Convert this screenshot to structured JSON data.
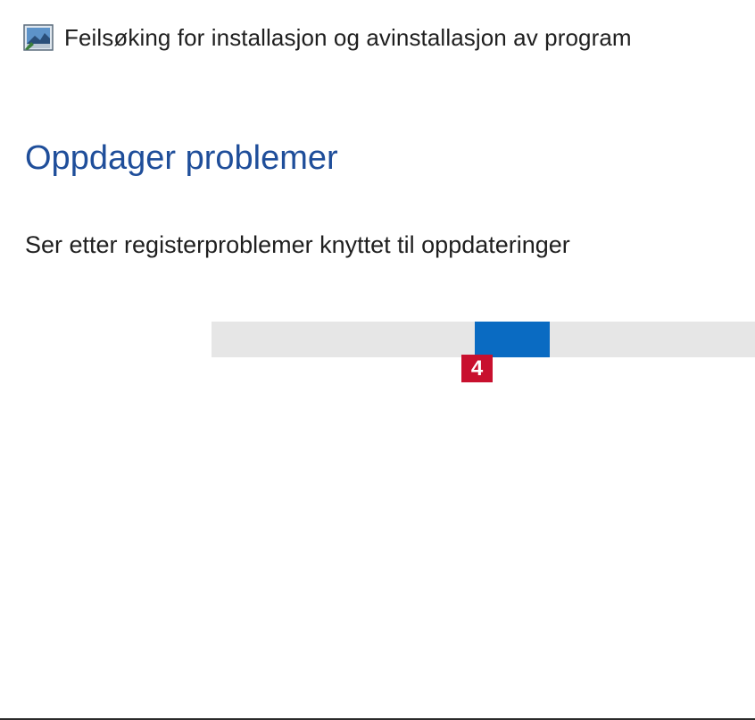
{
  "window": {
    "title": "Feilsøking for installasjon og avinstallasjon av program",
    "icon": "troubleshooter-icon"
  },
  "main": {
    "heading": "Oppdager problemer",
    "status": "Ser etter registerproblemer knyttet til oppdateringer"
  },
  "progress": {
    "mode": "indeterminate",
    "chunk_start_fraction": 0.485,
    "chunk_fraction": 0.138
  },
  "annotation": {
    "callout_number": "4"
  },
  "colors": {
    "heading": "#1f4e9a",
    "progress_fill": "#0a6bc2",
    "progress_track": "#e6e6e6",
    "callout": "#c8102e"
  }
}
